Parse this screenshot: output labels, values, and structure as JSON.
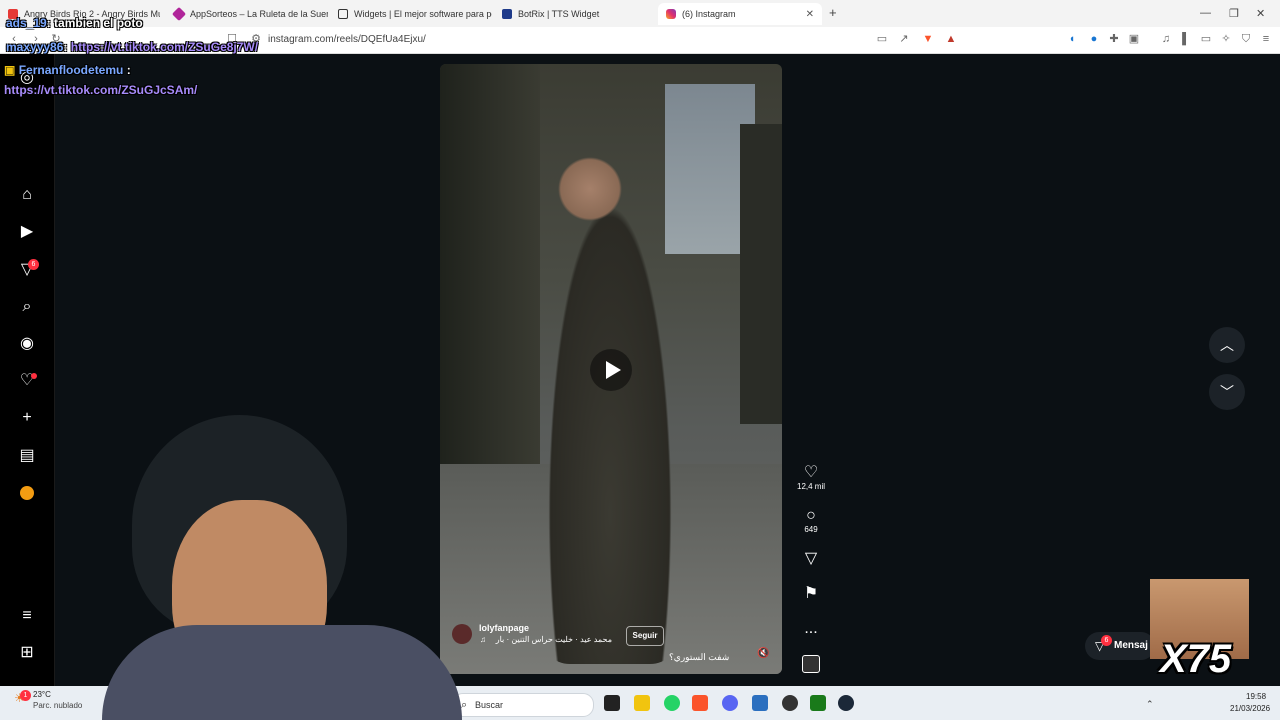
{
  "browser": {
    "tabs": [
      {
        "label": "Angry Birds Rio 2 - Angry Birds Mus",
        "color": "#e53935"
      },
      {
        "label": "AppSorteos – La Ruleta de la Suerte",
        "color": "#b0259a"
      },
      {
        "label": "Widgets | El mejor software para pot",
        "color": "#333333"
      },
      {
        "label": "BotRix | TTS Widget",
        "color": "#1e3a8a"
      },
      {
        "label": "(6) Instagram",
        "color": "#e1306c"
      }
    ],
    "new_tab": "+",
    "url": "instagram.com/reels/DQEfUa4Ejxu/"
  },
  "chat": [
    {
      "user": "ads_19",
      "text": ": tambien el poto"
    },
    {
      "user": "maxyyy86",
      "text": ": ",
      "link": "https://vt.tiktok.com/ZSuGe8j7W/"
    },
    {
      "user": "Fernanfloodetemu",
      "text": " :",
      "link": "https://vt.tiktok.com/ZSuGJcSAm/"
    }
  ],
  "reel": {
    "username": "lolyfanpage",
    "follow_label": "Seguir",
    "audio": "محمد عيد · خليت حراس التنين · بار",
    "caption": "شفت الستوري؟",
    "likes": "12,4 mil",
    "comments": "649",
    "more": "..."
  },
  "nav": {
    "notifications_badge": "6",
    "messages_label": "Mensaj",
    "messages_badge": "6"
  },
  "overlay": {
    "multiplier": "X75"
  },
  "taskbar": {
    "weather_temp": "23°C",
    "weather_desc": "Parc. nublado",
    "search_placeholder": "Buscar",
    "time": "19:58",
    "date": "21/03/2026",
    "notif_badge": "1"
  }
}
